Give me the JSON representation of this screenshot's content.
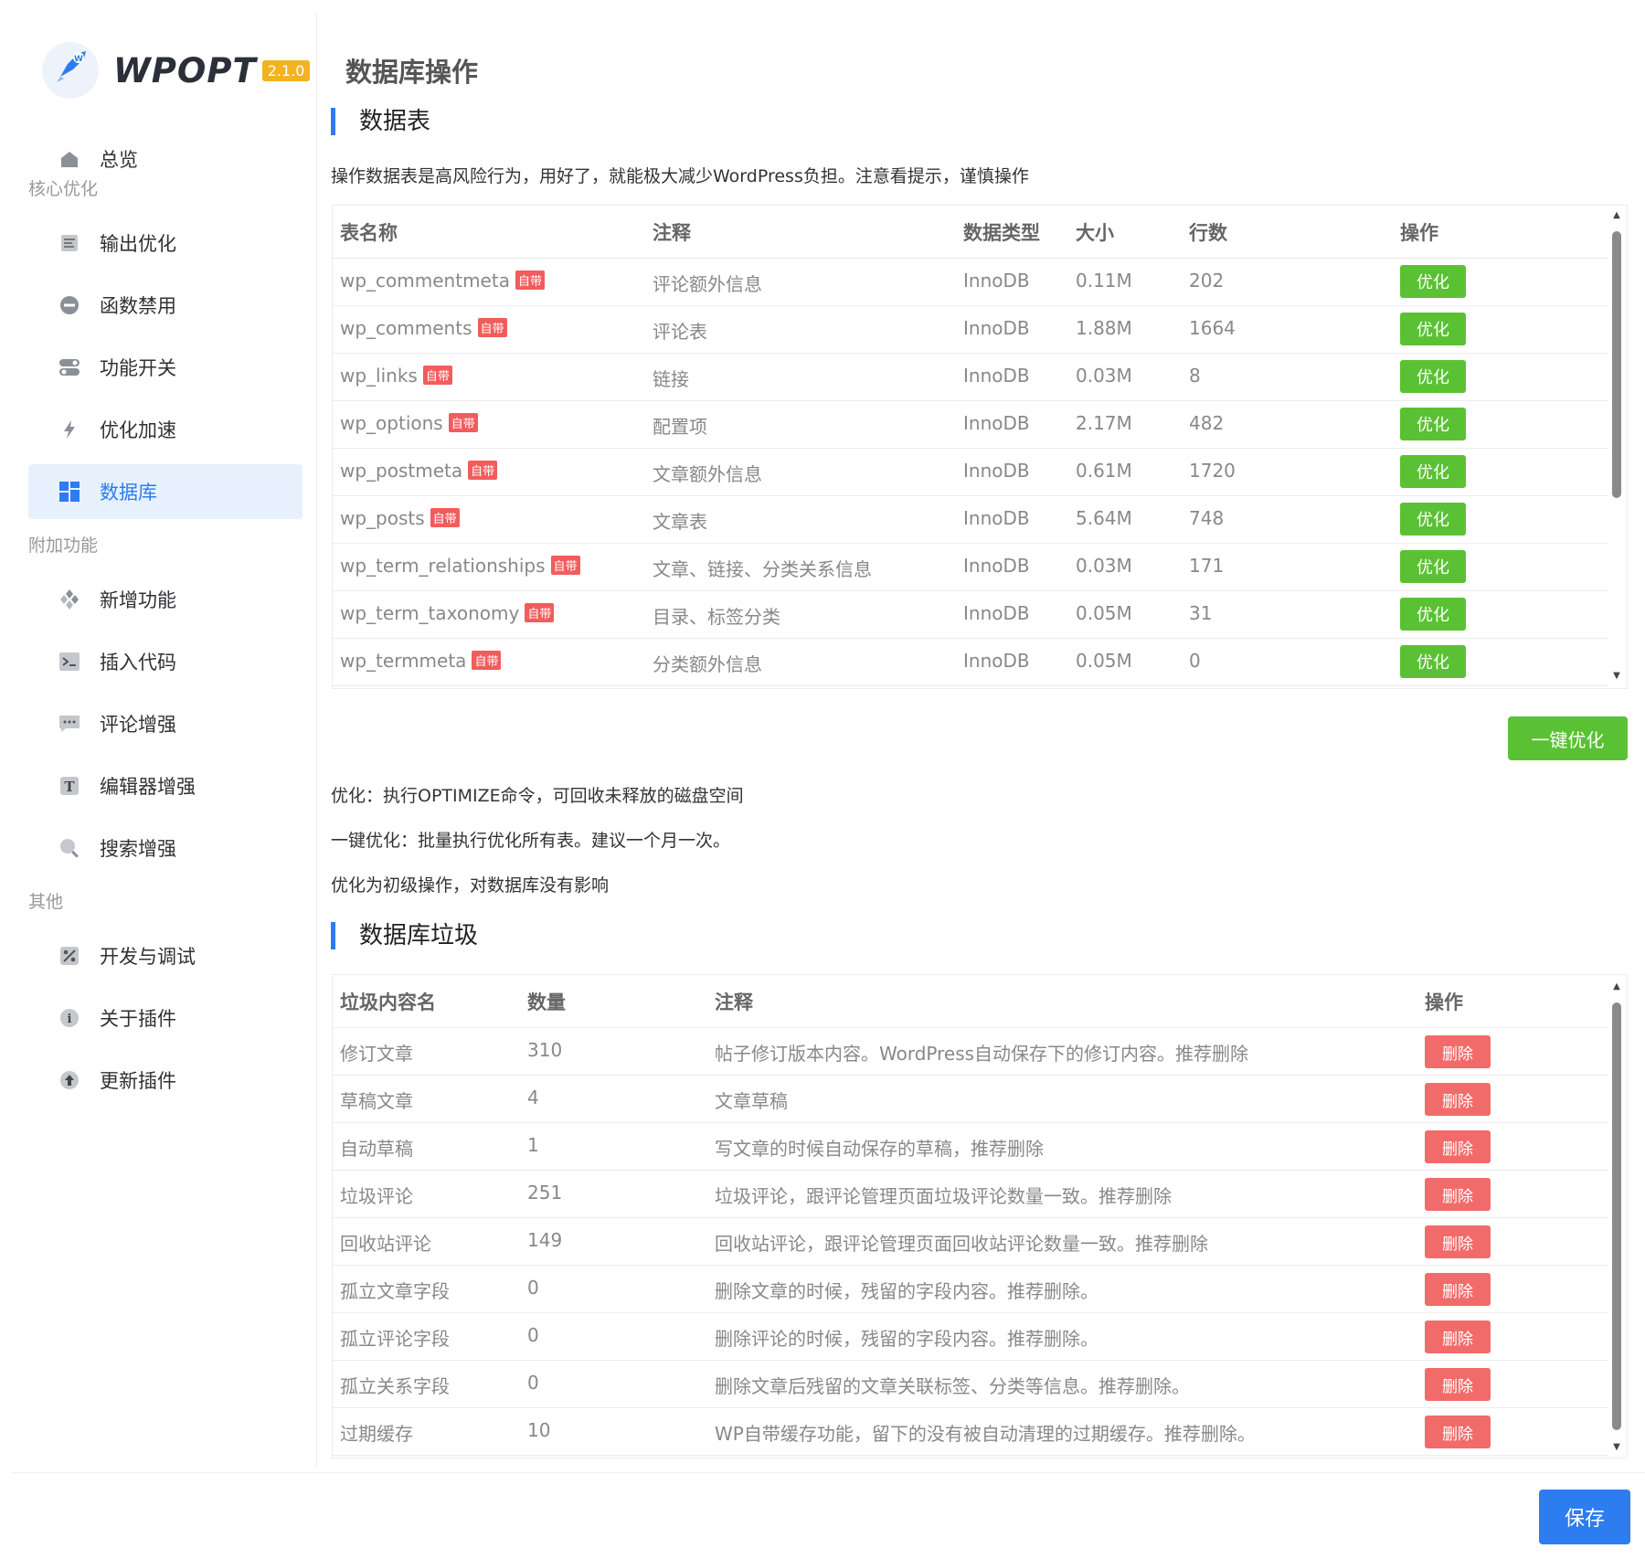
{
  "brand": {
    "name": "WPOPT",
    "version": "2.1.0"
  },
  "sidebar": {
    "overview": "总览",
    "groups": [
      "核心优化",
      "附加功能",
      "其他"
    ],
    "core": [
      {
        "label": "输出优化",
        "icon": "output-icon"
      },
      {
        "label": "函数禁用",
        "icon": "minus-circle-icon"
      },
      {
        "label": "功能开关",
        "icon": "toggle-icon"
      },
      {
        "label": "优化加速",
        "icon": "lightning-icon"
      },
      {
        "label": "数据库",
        "icon": "database-grid-icon"
      }
    ],
    "extra": [
      {
        "label": "新增功能",
        "icon": "diamonds-icon"
      },
      {
        "label": "插入代码",
        "icon": "terminal-icon"
      },
      {
        "label": "评论增强",
        "icon": "comment-icon"
      },
      {
        "label": "编辑器增强",
        "icon": "text-icon"
      },
      {
        "label": "搜索增强",
        "icon": "search-icon"
      }
    ],
    "other": [
      {
        "label": "开发与调试",
        "icon": "percent-icon"
      },
      {
        "label": "关于插件",
        "icon": "info-icon"
      },
      {
        "label": "更新插件",
        "icon": "upload-icon"
      }
    ]
  },
  "page": {
    "title": "数据库操作",
    "section_tables": "数据表",
    "tables_desc": "操作数据表是高风险行为，用好了，就能极大减少WordPress负担。注意看提示，谨慎操作",
    "section_garbage": "数据库垃圾",
    "notes": [
      "优化：执行OPTIMIZE命令，可回收未释放的磁盘空间",
      "一键优化：批量执行优化所有表。建议一个月一次。",
      "优化为初级操作，对数据库没有影响"
    ],
    "bulk_optimize": "一键优化",
    "save": "保存"
  },
  "tables": {
    "headers": [
      "表名称",
      "注释",
      "数据类型",
      "大小",
      "行数",
      "操作"
    ],
    "builtin_tag": "自带",
    "action_label": "优化",
    "rows": [
      {
        "name": "wp_commentmeta",
        "comment": "评论额外信息",
        "engine": "InnoDB",
        "size": "0.11M",
        "rows": "202"
      },
      {
        "name": "wp_comments",
        "comment": "评论表",
        "engine": "InnoDB",
        "size": "1.88M",
        "rows": "1664"
      },
      {
        "name": "wp_links",
        "comment": "链接",
        "engine": "InnoDB",
        "size": "0.03M",
        "rows": "8"
      },
      {
        "name": "wp_options",
        "comment": "配置项",
        "engine": "InnoDB",
        "size": "2.17M",
        "rows": "482"
      },
      {
        "name": "wp_postmeta",
        "comment": "文章额外信息",
        "engine": "InnoDB",
        "size": "0.61M",
        "rows": "1720"
      },
      {
        "name": "wp_posts",
        "comment": "文章表",
        "engine": "InnoDB",
        "size": "5.64M",
        "rows": "748"
      },
      {
        "name": "wp_term_relationships",
        "comment": "文章、链接、分类关系信息",
        "engine": "InnoDB",
        "size": "0.03M",
        "rows": "171"
      },
      {
        "name": "wp_term_taxonomy",
        "comment": "目录、标签分类",
        "engine": "InnoDB",
        "size": "0.05M",
        "rows": "31"
      },
      {
        "name": "wp_termmeta",
        "comment": "分类额外信息",
        "engine": "InnoDB",
        "size": "0.05M",
        "rows": "0"
      }
    ]
  },
  "garbage": {
    "headers": [
      "垃圾内容名",
      "数量",
      "注释",
      "操作"
    ],
    "action_label": "删除",
    "rows": [
      {
        "name": "修订文章",
        "count": "310",
        "comment": "帖子修订版本内容。WordPress自动保存下的修订内容。推荐删除"
      },
      {
        "name": "草稿文章",
        "count": "4",
        "comment": "文章草稿"
      },
      {
        "name": "自动草稿",
        "count": "1",
        "comment": "写文章的时候自动保存的草稿，推荐删除"
      },
      {
        "name": "垃圾评论",
        "count": "251",
        "comment": "垃圾评论，跟评论管理页面垃圾评论数量一致。推荐删除"
      },
      {
        "name": "回收站评论",
        "count": "149",
        "comment": "回收站评论，跟评论管理页面回收站评论数量一致。推荐删除"
      },
      {
        "name": "孤立文章字段",
        "count": "0",
        "comment": "删除文章的时候，残留的字段内容。推荐删除。"
      },
      {
        "name": "孤立评论字段",
        "count": "0",
        "comment": "删除评论的时候，残留的字段内容。推荐删除。"
      },
      {
        "name": "孤立关系字段",
        "count": "0",
        "comment": "删除文章后残留的文章关联标签、分类等信息。推荐删除。"
      },
      {
        "name": "过期缓存",
        "count": "10",
        "comment": "WP自带缓存功能，留下的没有被自动清理的过期缓存。推荐删除。"
      }
    ]
  },
  "colors": {
    "accent": "#2d7cf0",
    "success": "#5bc134",
    "danger": "#f26b6b",
    "active_bg": "#e7f1fe"
  }
}
